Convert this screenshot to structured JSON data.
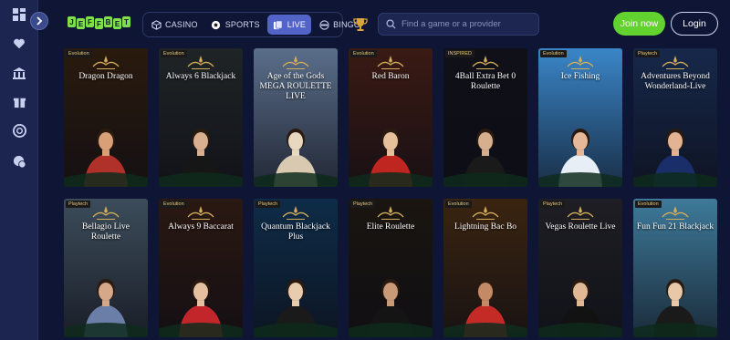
{
  "brand": {
    "logo_letters": [
      "J",
      "E",
      "F",
      "F",
      "B",
      "E",
      "T"
    ]
  },
  "nav": {
    "tabs": [
      {
        "label": "CASINO",
        "icon": "cube-icon",
        "active": false
      },
      {
        "label": "SPORTS",
        "icon": "soccer-ball-icon",
        "active": false
      },
      {
        "label": "LIVE",
        "icon": "live-cards-icon",
        "active": true
      },
      {
        "label": "BINGO",
        "icon": "bingo-ball-icon",
        "active": false
      }
    ]
  },
  "search": {
    "placeholder": "Find a game or a provider"
  },
  "auth": {
    "join_label": "Join now",
    "login_label": "Login"
  },
  "sidebar": {
    "items": [
      "grid-icon",
      "heart-icon",
      "casino-building-icon",
      "gift-icon",
      "chip-icon",
      "chat-support-icon"
    ]
  },
  "colors": {
    "accent": "#5264c8",
    "join": "#62d22f",
    "background": "#0f1635",
    "sidebar": "#1b2550"
  },
  "games": [
    {
      "title": "Dragon Dragon",
      "provider": "Evolution",
      "bg": "#2a1a0e",
      "dealer": "#b0302a",
      "skin": "#d9a078"
    },
    {
      "title": "Always 6 Blackjack",
      "provider": "Evolution",
      "bg": "#1f2426",
      "dealer": "#161616",
      "skin": "#d8b090"
    },
    {
      "title": "Age of the Gods MEGA ROULETTE LIVE",
      "provider": "",
      "bg": "#5a6e8a",
      "dealer": "#d8c9b0",
      "skin": "#e8d8c0"
    },
    {
      "title": "Red Baron",
      "provider": "Evolution",
      "bg": "#3a1a14",
      "dealer": "#c02620",
      "skin": "#e6c09a"
    },
    {
      "title": "4Ball Extra Bet 0 Roulette",
      "provider": "INSPIRED",
      "bg": "#101018",
      "dealer": "#1a1a1a",
      "skin": "#d6b08e"
    },
    {
      "title": "Ice Fishing",
      "provider": "Evolution",
      "bg": "#3a86c8",
      "dealer": "#e8eef6",
      "skin": "#e4b898"
    },
    {
      "title": "Adventures Beyond Wonderland-Live",
      "provider": "Playtech",
      "bg": "#16284a",
      "dealer": "#1a2e6a",
      "skin": "#e2b494"
    },
    {
      "title": "Bellagio Live Roulette",
      "provider": "Playtech",
      "bg": "#3c4c5a",
      "dealer": "#6a7ea8",
      "skin": "#d4a888"
    },
    {
      "title": "Always 9 Baccarat",
      "provider": "Evolution",
      "bg": "#2a1812",
      "dealer": "#c2262a",
      "skin": "#e4c0a0"
    },
    {
      "title": "Quantum Blackjack Plus",
      "provider": "Playtech",
      "bg": "#0e2c48",
      "dealer": "#1a1a1a",
      "skin": "#e8ccb0"
    },
    {
      "title": "Elite Roulette",
      "provider": "Playtech",
      "bg": "#1a1510",
      "dealer": "#141414",
      "skin": "#c89a78"
    },
    {
      "title": "Lightning Bac Bo",
      "provider": "Evolution",
      "bg": "#3a2410",
      "dealer": "#c42a26",
      "skin": "#c48a66"
    },
    {
      "title": "Vegas Roulette Live",
      "provider": "Playtech",
      "bg": "#1e1e24",
      "dealer": "#121212",
      "skin": "#e0b896"
    },
    {
      "title": "Fun Fun 21 Blackjack",
      "provider": "Evolution",
      "bg": "#3e7a9a",
      "dealer": "#1a1a1a",
      "skin": "#e8c8a8"
    }
  ]
}
